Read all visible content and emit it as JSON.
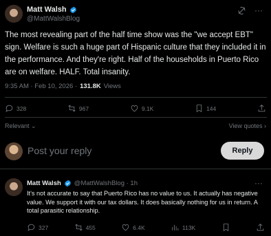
{
  "tweet": {
    "author_name": "Matt Walsh",
    "handle": "@MattWalshBlog",
    "text": "The most revealing part of the half time show was the \"we accept EBT\" sign. Welfare is such a huge part of Hispanic culture that they included it in the performance. And they're right. Half of the households in Puerto Rico are on welfare. HALF.  Total insanity.",
    "time": "9:35 AM · Feb 10, 2026 · ",
    "views_count": "131.8K",
    "views_label": "Views",
    "replies": "328",
    "reposts": "967",
    "likes": "9.1K",
    "bookmarks": "144"
  },
  "sort": {
    "label": "Relevant",
    "view_quotes": "View quotes"
  },
  "reply_box": {
    "placeholder": "Post your reply",
    "button": "Reply"
  },
  "reply": {
    "author_name": "Matt Walsh",
    "handle_time": "@MattWalshBlog · 1h",
    "text": "It's not accurate to say that Puerto Rico has no value to us. It actually has negative value. We support it with our tax dollars. It does basically nothing for us in return. A total parasitic relationship.",
    "replies": "327",
    "reposts": "455",
    "likes": "6.4K",
    "views": "113K"
  },
  "colors": {
    "verified": "#1d9bf0",
    "bg": "#000000",
    "text": "#e7e9ea",
    "muted": "#71767b"
  }
}
